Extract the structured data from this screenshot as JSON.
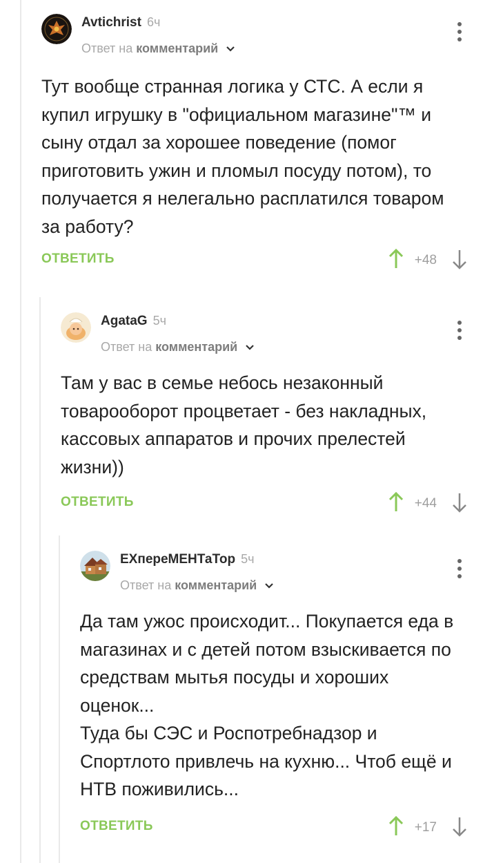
{
  "comments": [
    {
      "author": "Avtichrist",
      "time": "6ч",
      "reply_prefix": "Ответ на",
      "reply_link": "комментарий",
      "text": "Тут вообще странная логика у СТС. А если я купил игрушку в \"официальном магазине\"™ и сыну отдал за хорошее поведение (помог приготовить ужин и пломыл посуду потом), то получается я нелегально расплатился товаром за работу?",
      "reply_label": "ОТВЕТИТЬ",
      "score": "+48",
      "avatar_icon": "phoenix-avatar"
    },
    {
      "author": "AgataG",
      "time": "5ч",
      "reply_prefix": "Ответ на",
      "reply_link": "комментарий",
      "text": "Там у вас в семье небось незаконный товарооборот процветает - без накладных, кассовых аппаратов и прочих прелестей жизни))",
      "reply_label": "ОТВЕТИТЬ",
      "score": "+44",
      "avatar_icon": "cartoon-avatar"
    },
    {
      "author": "EXпереМЕНТаТор",
      "time": "5ч",
      "reply_prefix": "Ответ на",
      "reply_link": "комментарий",
      "text": "Да там ужос происходит... Покупается еда в магазинах и с детей потом взыскивается по средствам мытья посуды и хороших оценок...\nТуда бы СЭС и Роспотребнадзор и Спортлото привлечь на кухню... Чтоб ещё и НТВ поживились...",
      "reply_label": "ОТВЕТИТЬ",
      "score": "+17",
      "avatar_icon": "house-avatar"
    }
  ],
  "colors": {
    "accent": "#8ac858",
    "meta": "#a8a8a8",
    "text": "#222222"
  }
}
